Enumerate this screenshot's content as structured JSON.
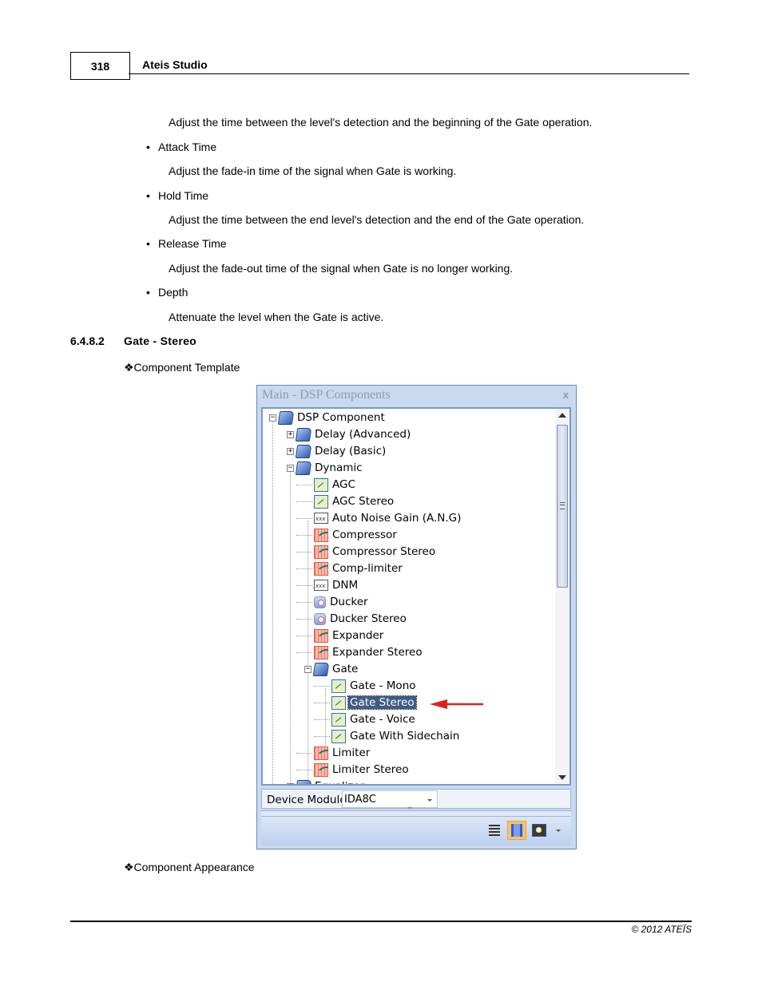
{
  "header": {
    "page_number": "318",
    "doc_title": "Ateis Studio"
  },
  "body": {
    "items": [
      {
        "type": "desc",
        "text": "Adjust the time between the level's detection and the beginning of the Gate operation."
      },
      {
        "type": "bullet",
        "text": "Attack Time"
      },
      {
        "type": "desc",
        "text": "Adjust the fade-in time of the signal when Gate is working."
      },
      {
        "type": "bullet",
        "text": "Hold Time"
      },
      {
        "type": "desc",
        "text": "Adjust the time between the end level's detection and the end of the Gate operation."
      },
      {
        "type": "bullet",
        "text": "Release Time"
      },
      {
        "type": "desc",
        "text": "Adjust the fade-out time of the signal when Gate is no longer working."
      },
      {
        "type": "bullet",
        "text": "Depth"
      },
      {
        "type": "desc",
        "text": "Attenuate the level when the Gate is active."
      }
    ],
    "section": {
      "number": "6.4.8.2",
      "title": "Gate - Stereo"
    },
    "subheading_template": "❖Component Template",
    "subheading_appearance": "❖Component Appearance"
  },
  "window": {
    "title": "Main - DSP Components",
    "close_label": "x",
    "tree": [
      {
        "label": "DSP Component",
        "icon": "folder-open-icon",
        "level": 0,
        "expander": "minus"
      },
      {
        "label": "Delay (Advanced)",
        "icon": "folder-icon",
        "level": 1,
        "expander": "plus"
      },
      {
        "label": "Delay (Basic)",
        "icon": "folder-icon",
        "level": 1,
        "expander": "plus"
      },
      {
        "label": "Dynamic",
        "icon": "folder-open-icon",
        "level": 1,
        "expander": "minus"
      },
      {
        "label": "AGC",
        "icon": "gate-icon",
        "level": 2
      },
      {
        "label": "AGC Stereo",
        "icon": "gate-icon",
        "level": 2
      },
      {
        "label": "Auto Noise Gain (A.N.G)",
        "icon": "noise-gain-icon",
        "level": 2
      },
      {
        "label": "Compressor",
        "icon": "compressor-icon",
        "level": 2
      },
      {
        "label": "Compressor Stereo",
        "icon": "compressor-icon",
        "level": 2
      },
      {
        "label": "Comp-limiter",
        "icon": "compressor-icon",
        "level": 2
      },
      {
        "label": "DNM",
        "icon": "noise-gain-icon",
        "level": 2
      },
      {
        "label": "Ducker",
        "icon": "ducker-icon",
        "level": 2
      },
      {
        "label": "Ducker Stereo",
        "icon": "ducker-icon",
        "level": 2
      },
      {
        "label": "Expander",
        "icon": "compressor-icon",
        "level": 2
      },
      {
        "label": "Expander Stereo",
        "icon": "compressor-icon",
        "level": 2
      },
      {
        "label": "Gate",
        "icon": "folder-open-icon",
        "level": 2,
        "expander": "minus"
      },
      {
        "label": "Gate - Mono",
        "icon": "gate-icon",
        "level": 3
      },
      {
        "label": "Gate Stereo",
        "icon": "gate-icon",
        "level": 3,
        "selected": true
      },
      {
        "label": "Gate - Voice",
        "icon": "gate-icon",
        "level": 3
      },
      {
        "label": "Gate With Sidechain",
        "icon": "gate-icon",
        "level": 3
      },
      {
        "label": "Limiter",
        "icon": "compressor-icon",
        "level": 2
      },
      {
        "label": "Limiter Stereo",
        "icon": "compressor-icon",
        "level": 2
      },
      {
        "label": "Equalizer",
        "icon": "folder-icon",
        "level": 1,
        "expander": "plus"
      }
    ],
    "device_module_label": "Device Module",
    "device_module_value": "IDA8C",
    "toolbar": [
      "list-view-icon",
      "split-view-icon",
      "image-view-icon"
    ],
    "annotation_arrow_color": "#e02020"
  },
  "footer": {
    "copyright": "© 2012 ATEÏS"
  }
}
